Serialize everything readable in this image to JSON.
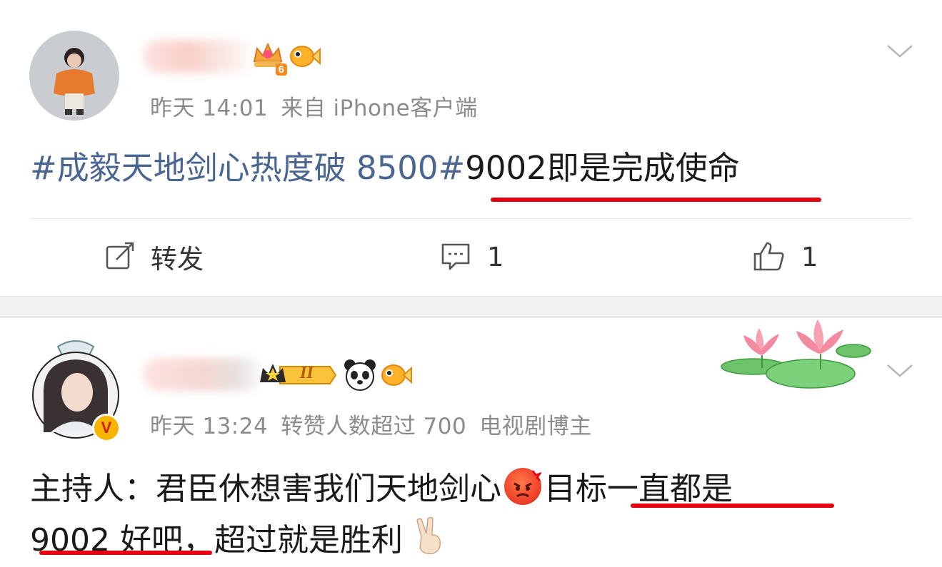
{
  "post1": {
    "meta": {
      "time": "昨天 14:01",
      "source": "来自 iPhone客户端"
    },
    "body": {
      "topic": "#成毅天地剑心热度破 8500#",
      "text": "9002即是完成使命"
    },
    "actions": {
      "repost_label": "转发",
      "comment_count": "1",
      "like_count": "1"
    },
    "level_badge": "6"
  },
  "post2": {
    "meta": {
      "time": "昨天 13:24",
      "info": "转赞人数超过 700",
      "tag": "电视剧博主"
    },
    "rank_badge": "II",
    "verified_mark": "V",
    "body": {
      "line1_a": "主持人：君臣休想害我们天地剑心",
      "line1_b": "目标一直都是",
      "line2_a": "9002 好吧，",
      "line2_b": "超过就是胜利"
    }
  },
  "colors": {
    "topic": "#4a6690",
    "underline": "#e3000f",
    "meta": "#8b8b8b",
    "gap": "#f1f1f1"
  },
  "icons": [
    "repost-icon",
    "comment-icon",
    "like-icon",
    "chevron-down-icon",
    "crown-badge-icon",
    "goldfish-icon",
    "panda-icon",
    "lotus-decoration",
    "victory-hand-emoji",
    "angry-emoji"
  ]
}
